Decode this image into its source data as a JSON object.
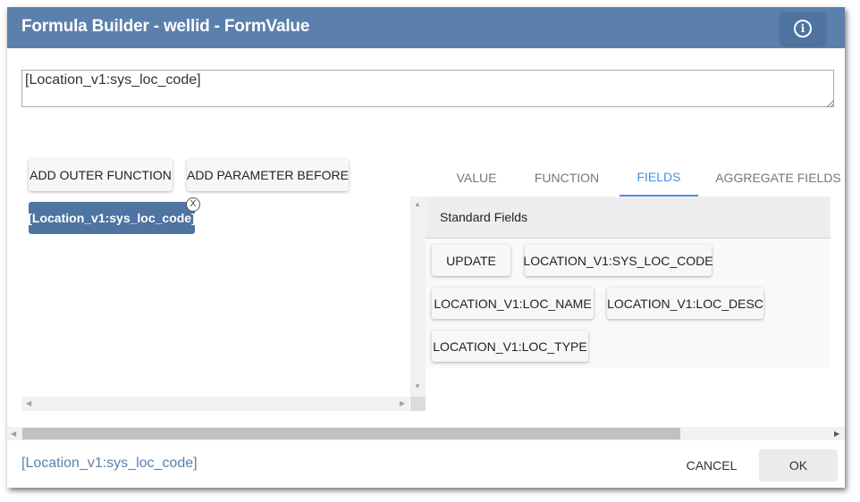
{
  "dialog": {
    "title": "Formula Builder - wellid - FormValue",
    "info_icon": "info-circle-icon"
  },
  "formula_input": {
    "value": "[Location_v1:sys_loc_code]"
  },
  "builder": {
    "add_outer_function_label": "ADD OUTER FUNCTION",
    "add_parameter_before_label": "ADD PARAMETER BEFORE",
    "chip_label": "[Location_v1:sys_loc_code]",
    "chip_close_label": "X"
  },
  "tabs": [
    {
      "label": "VALUE",
      "active": false
    },
    {
      "label": "FUNCTION",
      "active": false
    },
    {
      "label": "FIELDS",
      "active": true
    },
    {
      "label": "AGGREGATE FIELDS",
      "active": false
    }
  ],
  "fields_panel": {
    "header": "Standard Fields",
    "fields": [
      "UPDATE",
      "LOCATION_V1:SYS_LOC_CODE",
      "LOCATION_V1:LOC_NAME",
      "LOCATION_V1:LOC_DESC",
      "LOCATION_V1:LOC_TYPE"
    ]
  },
  "footer": {
    "formula_preview": "[Location_v1:sys_loc_code]",
    "cancel_label": "CANCEL",
    "ok_label": "OK"
  },
  "colors": {
    "titlebar": "#5b80ad",
    "chip": "#4e74a1",
    "active_tab": "#4a8ee6"
  }
}
